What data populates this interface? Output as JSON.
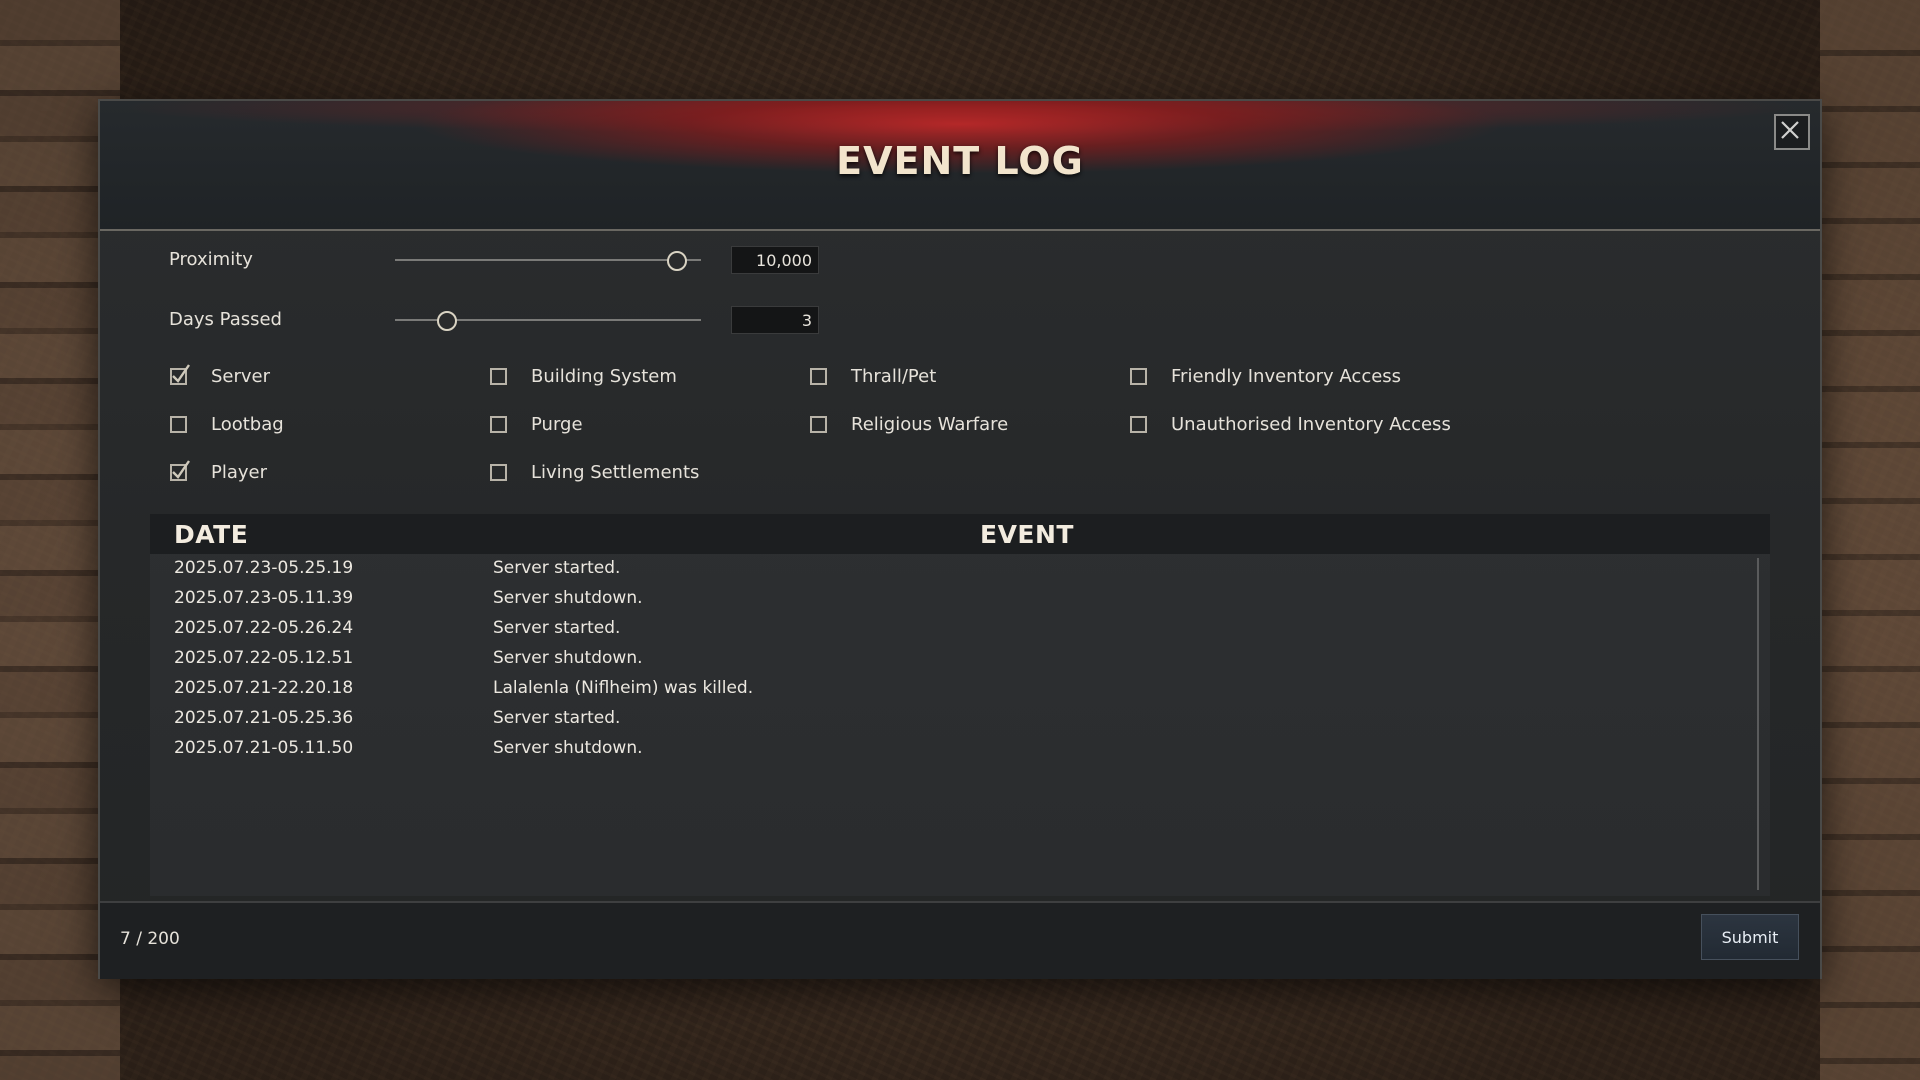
{
  "window": {
    "title": "EVENT LOG"
  },
  "filters": {
    "proximity": {
      "label": "Proximity",
      "value": "10,000",
      "slider_fraction": 0.92
    },
    "days_passed": {
      "label": "Days Passed",
      "value": "3",
      "slider_fraction": 0.17
    }
  },
  "categories": [
    {
      "label": "Server",
      "checked": true
    },
    {
      "label": "Building System",
      "checked": false
    },
    {
      "label": "Thrall/Pet",
      "checked": false
    },
    {
      "label": "Friendly Inventory Access",
      "checked": false
    },
    {
      "label": "Lootbag",
      "checked": false
    },
    {
      "label": "Purge",
      "checked": false
    },
    {
      "label": "Religious Warfare",
      "checked": false
    },
    {
      "label": "Unauthorised Inventory Access",
      "checked": false
    },
    {
      "label": "Player",
      "checked": true
    },
    {
      "label": "Living Settlements",
      "checked": false
    }
  ],
  "table": {
    "columns": {
      "date": "DATE",
      "event": "EVENT"
    },
    "rows": [
      {
        "date": "2025.07.23-05.25.19",
        "event": "Server started."
      },
      {
        "date": "2025.07.23-05.11.39",
        "event": "Server shutdown."
      },
      {
        "date": "2025.07.22-05.26.24",
        "event": "Server started."
      },
      {
        "date": "2025.07.22-05.12.51",
        "event": "Server shutdown."
      },
      {
        "date": "2025.07.21-22.20.18",
        "event": "Lalalenla (Niflheim) was killed."
      },
      {
        "date": "2025.07.21-05.25.36",
        "event": "Server started."
      },
      {
        "date": "2025.07.21-05.11.50",
        "event": "Server shutdown."
      }
    ]
  },
  "footer": {
    "count": "7 / 200",
    "submit_label": "Submit"
  },
  "icons": {
    "close": "close-icon",
    "check": "checkmark-icon"
  },
  "colors": {
    "accent_red": "#b22222",
    "title_text": "#f2e4cc",
    "panel": "#2a2c2e"
  }
}
